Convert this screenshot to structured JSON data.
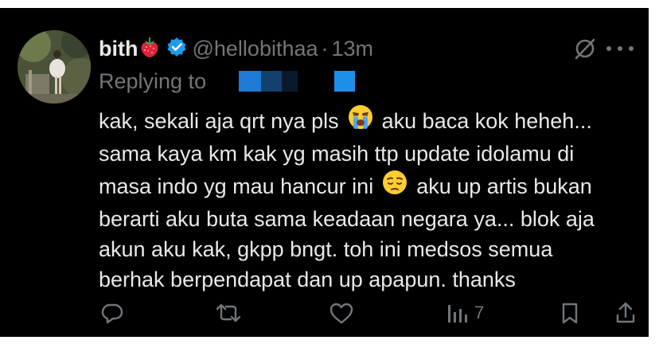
{
  "tweet": {
    "display_name": "bith",
    "name_emoji": "strawberry-emoji",
    "handle": "@hellobithaa",
    "separator": "·",
    "time": "13m",
    "replying_to_label": "Replying to",
    "lines": [
      {
        "text": "kak, sekali aja qrt nya pls",
        "emoji": "loudly-crying-face-emoji",
        "after": "aku baca kok heheh..."
      },
      {
        "text": "sama kaya km kak yg masih ttp update idolamu di"
      },
      {
        "text": "masa indo yg mau hancur ini",
        "emoji": "pensive-face-emoji",
        "after": "aku up artis bukan"
      },
      {
        "text": "berarti aku buta sama keadaan negara ya... blok aja"
      },
      {
        "text": "akun aku kak, gkpp bngt. toh ini medsos semua"
      },
      {
        "text": "berhak berpendapat dan up apapun. thanks"
      }
    ],
    "views_count": "7"
  },
  "icons": {
    "verified": "verified-badge-icon",
    "grok": "grok-icon",
    "more": "more-icon",
    "reply": "reply-icon",
    "retweet": "retweet-icon",
    "like": "heart-icon",
    "views": "views-icon",
    "bookmark": "bookmark-icon",
    "share": "share-icon"
  },
  "colors": {
    "background": "#000000",
    "primary_text": "#e7e9ea",
    "secondary_text": "#71767b",
    "verified_blue": "#1d9bf0"
  }
}
